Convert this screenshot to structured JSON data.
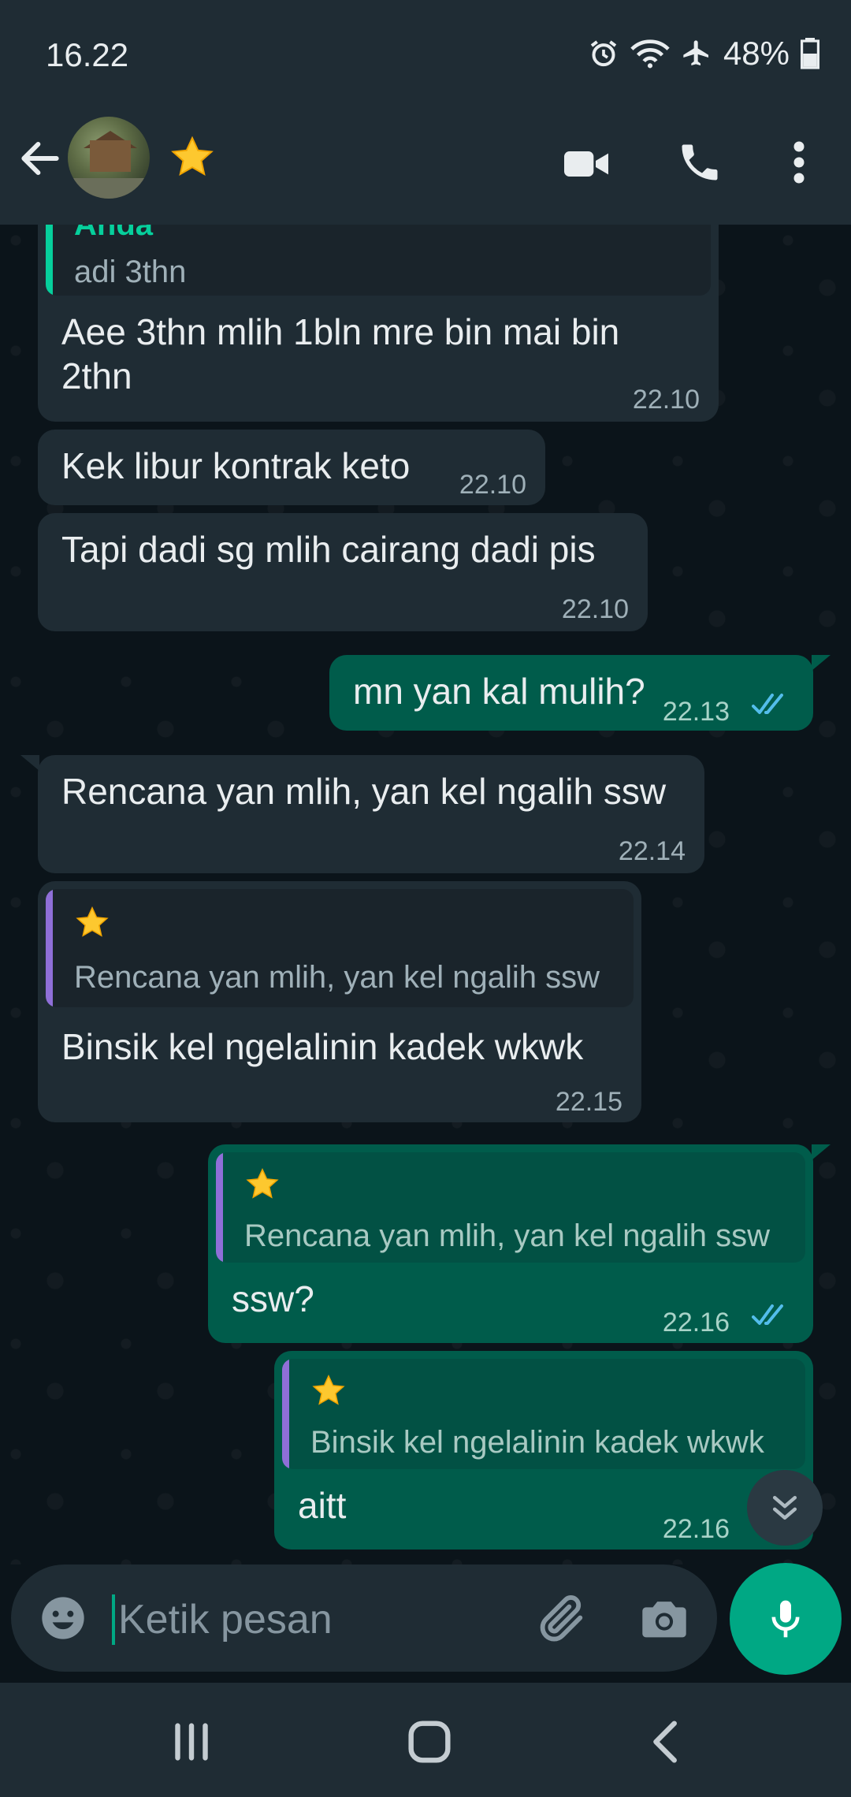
{
  "status_bar": {
    "time": "16.22",
    "battery": "48%",
    "icons": [
      "alarm-icon",
      "wifi-icon",
      "airplane-icon",
      "battery-icon"
    ]
  },
  "app_bar": {
    "icons": [
      "back-arrow-icon",
      "contact-avatar",
      "star-icon",
      "video-call-icon",
      "voice-call-icon",
      "more-options-icon"
    ]
  },
  "colors": {
    "incoming_bubble": "#1f2c34",
    "outgoing_bubble": "#005c4b",
    "accent": "#00a884",
    "read_ticks": "#53bdeb",
    "quote_bar_purple": "#8f6fd8",
    "quote_bar_green": "#06cf9c"
  },
  "messages": [
    {
      "direction": "in",
      "quote": {
        "name": "Anda",
        "text": "adi 3thn"
      },
      "lines": [
        "Aee 3thn mlih 1bln mre bin mai bin",
        "2thn"
      ],
      "time": "22.10"
    },
    {
      "direction": "in",
      "lines": [
        "Kek libur kontrak keto"
      ],
      "time": "22.10"
    },
    {
      "direction": "in",
      "lines": [
        "Tapi dadi sg mlih cairang dadi pis"
      ],
      "time": "22.10"
    },
    {
      "direction": "out",
      "lines": [
        "mn yan kal mulih?"
      ],
      "time": "22.13",
      "status": "read"
    },
    {
      "direction": "in",
      "lines": [
        "Rencana yan mlih, yan kel ngalih ssw"
      ],
      "time": "22.14"
    },
    {
      "direction": "in",
      "quote": {
        "name_icon": "star-icon",
        "text": "Rencana yan mlih, yan kel ngalih ssw"
      },
      "lines": [
        "Binsik kel ngelalinin kadek wkwk"
      ],
      "time": "22.15"
    },
    {
      "direction": "out",
      "quote": {
        "name_icon": "star-icon",
        "text": "Rencana yan mlih, yan kel ngalih ssw"
      },
      "lines": [
        "ssw?"
      ],
      "time": "22.16",
      "status": "read"
    },
    {
      "direction": "out",
      "quote": {
        "name_icon": "star-icon",
        "text": "Binsik kel ngelalinin kadek wkwk"
      },
      "lines": [
        "aitt"
      ],
      "time": "22.16"
    }
  ],
  "composer": {
    "placeholder": "Ketik pesan",
    "icons": [
      "emoji-icon",
      "attach-icon",
      "camera-icon",
      "mic-icon"
    ]
  },
  "nav_bar": {
    "icons": [
      "recent-apps-icon",
      "home-icon",
      "back-icon"
    ]
  }
}
